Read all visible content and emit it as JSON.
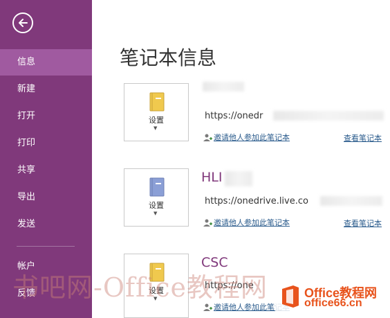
{
  "sidebar": {
    "items": [
      {
        "label": "信息",
        "active": true
      },
      {
        "label": "新建"
      },
      {
        "label": "打开"
      },
      {
        "label": "打印"
      },
      {
        "label": "共享"
      },
      {
        "label": "导出"
      },
      {
        "label": "发送"
      },
      {
        "label": "帐户"
      },
      {
        "label": "反馈"
      }
    ]
  },
  "main": {
    "title": "笔记本信息",
    "notebooks": [
      {
        "name": "",
        "url": "https://onedr",
        "settings_label": "设置",
        "invite_label": "邀请他人参加此笔记本",
        "view_label": "查看笔记本",
        "color": "#f0c94e"
      },
      {
        "name": "HLI",
        "url": "https://onedrive.live.co",
        "settings_label": "设置",
        "invite_label": "邀请他人参加此笔记本",
        "view_label": "查看笔记本",
        "color": "#8b9fd6"
      },
      {
        "name": "CSC",
        "url": "https://one",
        "settings_label": "设置",
        "invite_label": "邀请他人参加此笔记本",
        "view_label": "",
        "color": "#f0c94e"
      }
    ]
  },
  "watermark": {
    "text": "书吧网-Office教程网",
    "logo_line1": "Office教程网",
    "logo_line2": "office66.cn"
  },
  "colors": {
    "sidebar": "#80397b",
    "active": "#a05aa0",
    "accent": "#80397b",
    "link": "#2a5b8c"
  }
}
